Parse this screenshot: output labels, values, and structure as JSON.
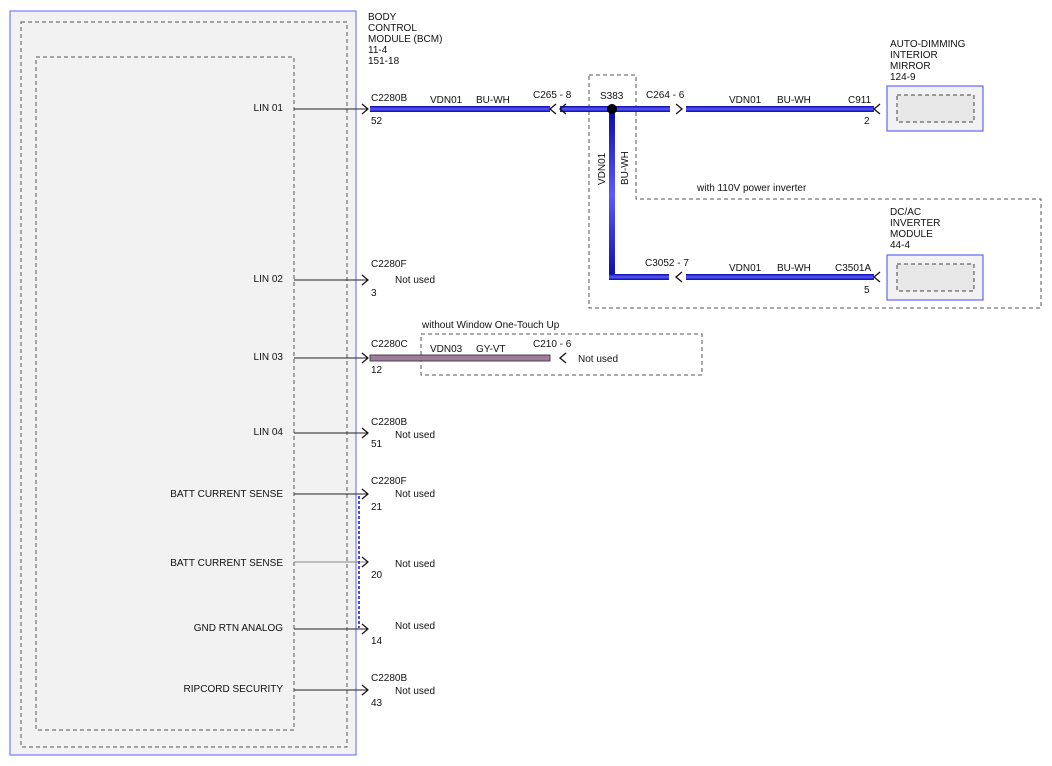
{
  "bcm": {
    "title_lines": [
      "BODY",
      "CONTROL",
      "MODULE (BCM)",
      "11-4",
      "151-18"
    ],
    "pins": [
      {
        "label": "LIN 01"
      },
      {
        "label": "LIN 02"
      },
      {
        "label": "LIN 03"
      },
      {
        "label": "LIN 04"
      },
      {
        "label": "BATT CURRENT SENSE"
      },
      {
        "label": "BATT CURRENT SENSE"
      },
      {
        "label": "GND RTN ANALOG"
      },
      {
        "label": "RIPCORD SECURITY"
      }
    ]
  },
  "connectors": {
    "c1": {
      "name": "C2280B",
      "pin": "52"
    },
    "c2": {
      "name": "C2280F",
      "pin": "3",
      "note": "Not used"
    },
    "c3": {
      "name": "C2280C",
      "pin": "12"
    },
    "c4": {
      "name": "C2280B",
      "pin": "51",
      "note": "Not used"
    },
    "c5": {
      "name": "C2280F",
      "pin": "21",
      "note": "Not used"
    },
    "c6": {
      "pin": "20",
      "note": "Not used"
    },
    "c7": {
      "pin": "14",
      "note": "Not used"
    },
    "c8": {
      "name": "C2280B",
      "pin": "43",
      "note": "Not used"
    }
  },
  "wires": {
    "w1_circuit": "VDN01",
    "w1_color": "BU-WH",
    "c265": "C265 - 8",
    "splice": "S383",
    "c264": "C264 - 6",
    "w2_circuit": "VDN01",
    "w2_color": "BU-WH",
    "c911_name": "C911",
    "c911_pin": "2",
    "vert_circuit": "VDN01",
    "vert_color": "BU-WH",
    "option_inverter": "with 110V power inverter",
    "c3052": "C3052 - 7",
    "w3_circuit": "VDN01",
    "w3_color": "BU-WH",
    "c3501_name": "C3501A",
    "c3501_pin": "5",
    "option_onetouch": "without Window One-Touch Up",
    "w4_circuit": "VDN03",
    "w4_color": "GY-VT",
    "c210": "C210 - 6",
    "c210_note": "Not used"
  },
  "mirror": {
    "title_lines": [
      "AUTO-DIMMING",
      "INTERIOR",
      "MIRROR",
      "124-9"
    ]
  },
  "inverter": {
    "title_lines": [
      "DC/AC",
      "INVERTER",
      "MODULE",
      "44-4"
    ]
  },
  "colors": {
    "wire_blue": "#1010d0",
    "wire_gray_violet": "#a07a9a",
    "box_border": "#6464ff",
    "box_fill": "#f2f2f2"
  }
}
